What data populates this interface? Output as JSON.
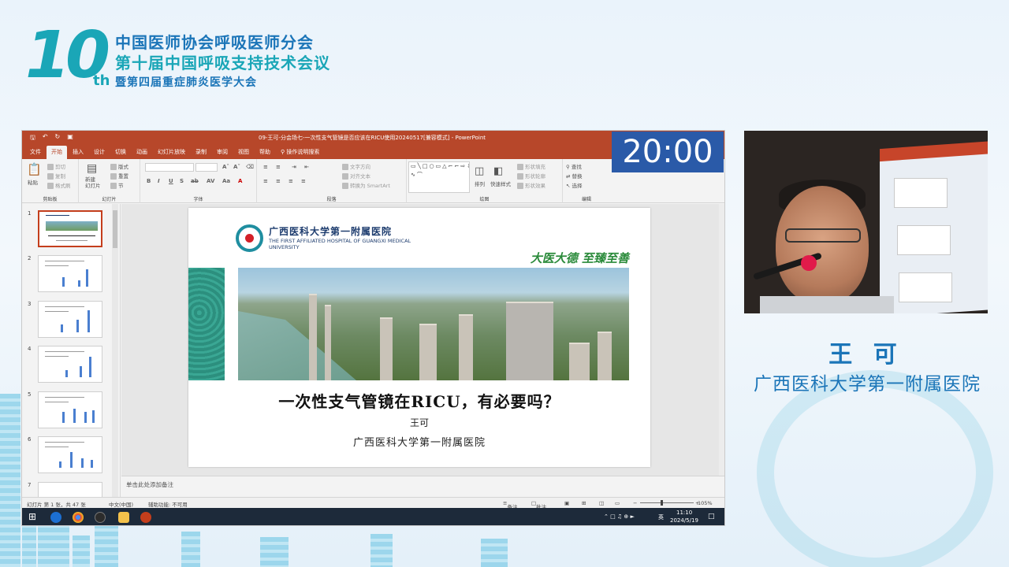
{
  "banner": {
    "logo_number": "10",
    "logo_suffix": "th",
    "line1": "中国医师协会呼吸医师分会",
    "line2": "第十届中国呼吸支持技术会议",
    "line3": "暨第四届重症肺炎医学大会",
    "color_primary": "#1b75b8",
    "color_accent": "#1aa6b7"
  },
  "ppt": {
    "window_title": "09-王可-分会场七-一次性支气管镜是否应该在RICU使用20240517[兼容模式] - PowerPoint",
    "menu": [
      "文件",
      "开始",
      "插入",
      "设计",
      "切换",
      "动画",
      "幻灯片放映",
      "录制",
      "审阅",
      "视图",
      "帮助",
      "操作说明搜索"
    ],
    "active_menu": "开始",
    "ribbon": {
      "clipboard": {
        "label": "剪贴板",
        "paste": "粘贴",
        "cut": "剪切",
        "copy": "复制",
        "format_painter": "格式刷"
      },
      "slides": {
        "label": "幻灯片",
        "new_slide": "新建\n幻灯片",
        "layout": "版式",
        "reset": "重置",
        "section": "节"
      },
      "font": {
        "label": "字体"
      },
      "paragraph": {
        "label": "段落",
        "text_direction": "文字方向",
        "align_text": "对齐文本",
        "smartart": "转换为 SmartArt"
      },
      "drawing": {
        "label": "绘图",
        "arrange": "排列",
        "quick_styles": "快速样式",
        "shape_fill": "形状填充",
        "shape_outline": "形状轮廓",
        "shape_effects": "形状效果"
      },
      "editing": {
        "label": "编辑",
        "find": "查找",
        "replace": "替换",
        "select": "选择"
      }
    },
    "thumbnail_numbers": [
      "1",
      "2",
      "3",
      "4",
      "5",
      "6",
      "7"
    ],
    "slide": {
      "hospital_cn": "广西医科大学第一附属医院",
      "hospital_en": "THE FIRST AFFILIATED HOSPITAL OF GUANGXI MEDICAL UNIVERSITY",
      "motto": "大医大德 至臻至善",
      "title": "一次性支气管镜在RICU，有必要吗？",
      "author": "王可",
      "affiliation": "广西医科大学第一附属医院"
    },
    "notes_placeholder": "单击此处添加备注",
    "status": {
      "slide_count": "幻灯片 第 1 张，共 47 张",
      "language": "中文(中国)",
      "accessibility": "辅助功能: 不可用",
      "notes": "备注",
      "comments": "批注",
      "zoom": "105%"
    },
    "taskbar": {
      "ime": "英",
      "time": "11:10",
      "date": "2024/5/19"
    }
  },
  "timer": "20:00",
  "speaker": {
    "name": "王 可",
    "affiliation": "广西医科大学第一附属医院"
  }
}
